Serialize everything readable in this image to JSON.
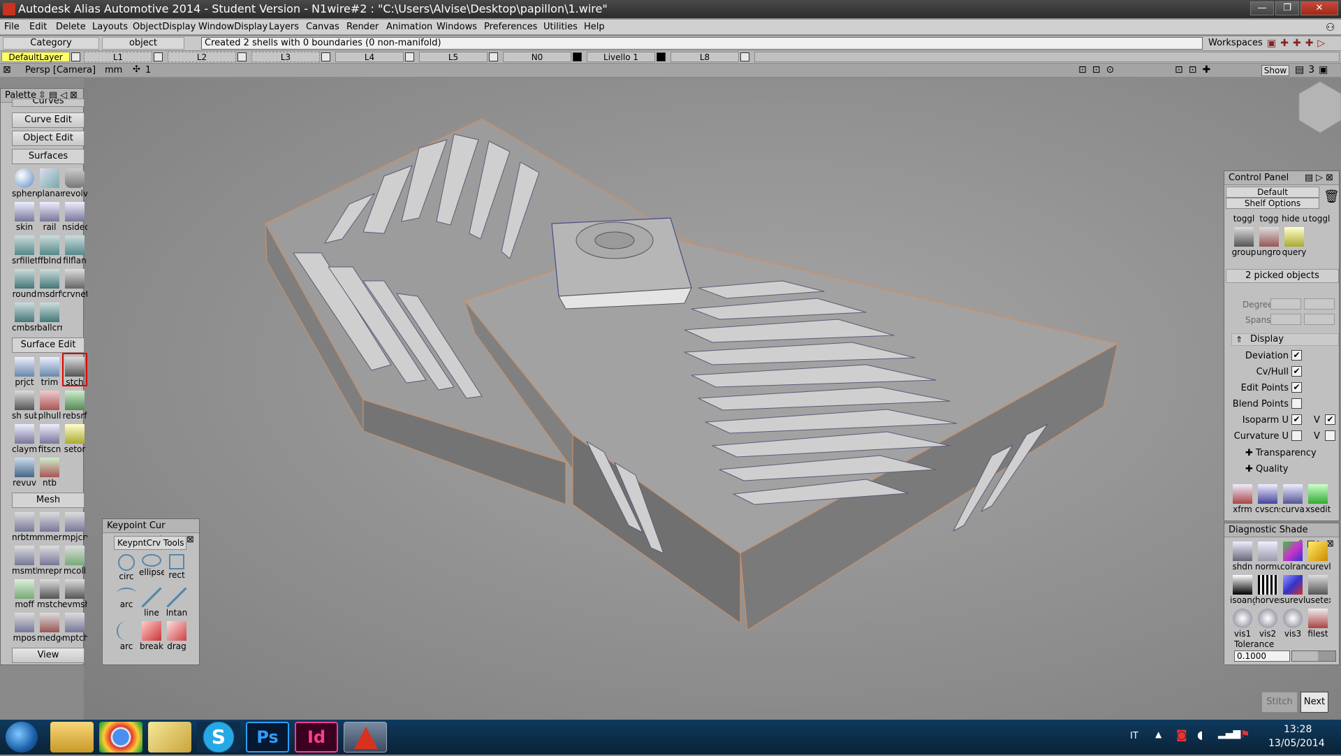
{
  "window": {
    "title": "Autodesk Alias Automotive 2014   - Student Version   - N1wire#2 : \"C:\\Users\\Alvise\\Desktop\\papillon\\1.wire\"",
    "min": "—",
    "max": "❐",
    "close": "✕"
  },
  "menu": [
    "File",
    "Edit",
    "Delete",
    "Layouts",
    "ObjectDisplay",
    "WindowDisplay",
    "Layers",
    "Canvas",
    "Render",
    "Animation",
    "Windows",
    "Preferences",
    "Utilities",
    "Help"
  ],
  "infobar": {
    "category_label": "Category",
    "mode": "object",
    "message": "Created 2 shells with 0 boundaries (0 non-manifold)",
    "workspaces": "Workspaces"
  },
  "layers": [
    "DefaultLayer",
    "L1",
    "L2",
    "L3",
    "L4",
    "L5",
    "N0",
    "Livello 1",
    "L8"
  ],
  "viewbar": {
    "camera": "Persp [Camera]",
    "units": "mm",
    "grid": "1",
    "show": "Show"
  },
  "palette": {
    "title": "Palette",
    "curves": "Curves",
    "curve_edit": "Curve Edit",
    "object_edit": "Object Edit",
    "surfaces": "Surfaces",
    "surface_tools": [
      "sphere",
      "planar",
      "revolv",
      "skin",
      "rail",
      "nsided",
      "srfillet",
      "ffblnd",
      "filflan",
      "round",
      "msdrft",
      "crvnet",
      "cmbsrf",
      "ballcrn"
    ],
    "surface_edit": "Surface Edit",
    "surface_edit_tools": [
      "prjct",
      "trim",
      "stch",
      "sh sub",
      "plhull",
      "rebsrf",
      "claymt",
      "fitscn",
      "setor",
      "revuv",
      "ntb"
    ],
    "mesh": "Mesh",
    "mesh_tools": [
      "nrbtm",
      "mmerg",
      "mpjcrv",
      "msmth",
      "mrepr",
      "mcoll",
      "moff",
      "mstch",
      "evmsh",
      "mpos",
      "medge",
      "mptch"
    ],
    "view": "View"
  },
  "keypoint": {
    "title": "Keypoint Cur",
    "tab": "KeypntCrv Tools",
    "tools": [
      "circ",
      "ellipse",
      "rect",
      "arc",
      "line",
      "lntan",
      "arc",
      "break",
      "drag"
    ]
  },
  "control_panel": {
    "title": "Control Panel",
    "preset": "Default",
    "shelf": "Shelf Options",
    "shelf_tools": [
      "toggl",
      "togg",
      "hide u",
      "toggl",
      "group",
      "ungrou",
      "query"
    ],
    "picked": "2 picked objects",
    "degree": "Degree",
    "spans": "Spans",
    "display": "Display",
    "rows": [
      {
        "label": "Deviation",
        "checked": "✔"
      },
      {
        "label": "Cv/Hull",
        "checked": "✔"
      },
      {
        "label": "Edit Points",
        "checked": "✔"
      },
      {
        "label": "Blend Points",
        "checked": ""
      },
      {
        "label": "Isoparm U",
        "checked": "✔",
        "v": "✔"
      },
      {
        "label": "Curvature U",
        "checked": "",
        "v": ""
      }
    ],
    "v_label": "V",
    "transparency": "Transparency",
    "quality": "Quality",
    "bottom_tools": [
      "xfrm",
      "cvscnsrf",
      "curva",
      "xsedit"
    ]
  },
  "diagnostic": {
    "title": "Diagnostic Shade",
    "tools": [
      "shdn",
      "normul",
      "colrancol",
      "curevl",
      "isoang",
      "horver",
      "surevl",
      "usetex",
      "vis1",
      "vis2",
      "vis3",
      "filest"
    ],
    "tolerance_label": "Tolerance",
    "tolerance": "0.1000"
  },
  "footer": {
    "stitch": "Stitch",
    "next": "Next"
  },
  "taskbar": {
    "lang": "IT",
    "time": "13:28",
    "date": "13/05/2014",
    "apps": [
      "explorer",
      "chrome",
      "files",
      "skype",
      "photoshop",
      "indesign",
      "alias"
    ],
    "ps": "Ps",
    "id": "Id",
    "skype": "S"
  },
  "colors": {
    "title": "#333333",
    "panel": "#c0c0c0",
    "viewport": "#8a8a8a",
    "layer_active": "#ffff66",
    "taskbar": "#0f3a5e"
  }
}
